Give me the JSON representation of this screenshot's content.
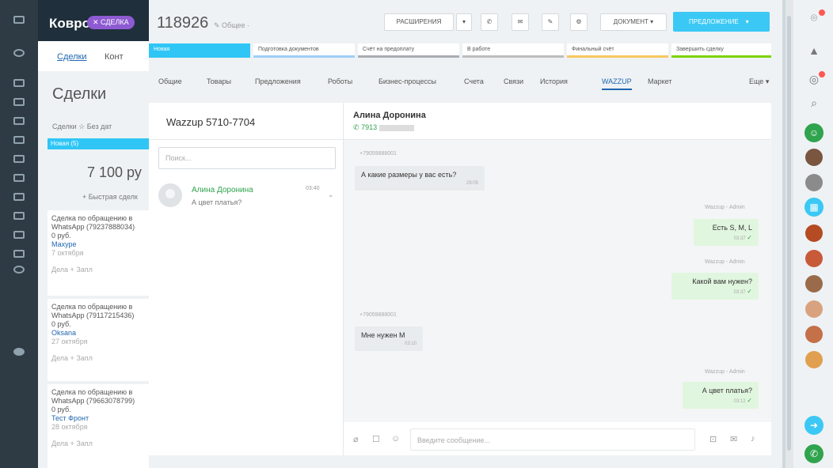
{
  "background": {
    "logo": "Ковро",
    "open_tab_badge": "✕ СДЕЛКА",
    "nav": [
      "Сделки",
      "Конт"
    ],
    "page_title": "Сделки",
    "filter": "Сделки ☆ Без дат",
    "stage": "Новая (5)",
    "sum": "7 100 ру",
    "add_quick": "+ Быстрая сделк",
    "cards": [
      {
        "title": "Сделка по обращению в WhatsApp (79237888034)",
        "amount": "0 руб.",
        "who": "Махуре",
        "date": "7 октября",
        "foot": "Дела      + Запл"
      },
      {
        "title": "Сделка по обращению в WhatsApp (79117215436)",
        "amount": "0 руб.",
        "who": "Oksana",
        "date": "27 октября",
        "foot": "Дела      + Запл"
      },
      {
        "title": "Сделка по обращению в WhatsApp (79663078799)",
        "amount": "0 руб.",
        "who": "Тест Фронт",
        "date": "28 октября",
        "foot": "Дела      + Запл"
      }
    ]
  },
  "deal": {
    "id": "118926",
    "category": "Общее ·",
    "toolbar": {
      "extensions": "РАСШИРЕНИЯ",
      "document": "ДОКУМЕНТ",
      "primary": "ПРЕДЛОЖЕНИЕ"
    },
    "stages": [
      {
        "label": "Новая",
        "color": "#2fc6f6"
      },
      {
        "label": "Подготовка документов",
        "color": "#9dcef8"
      },
      {
        "label": "Счёт на предоплату",
        "color": "#a8adb4"
      },
      {
        "label": "В работе",
        "color": "#bdbdbd"
      },
      {
        "label": "Финальный счёт",
        "color": "#f7c75f"
      },
      {
        "label": "Завершить сделку",
        "color": "#7bd500"
      }
    ],
    "tabs": [
      "Общие",
      "Товары",
      "Предложения",
      "Роботы",
      "Бизнес-процессы",
      "Счета",
      "Связи",
      "История",
      "WAZZUP",
      "Маркет"
    ],
    "tabs_more": "Еще",
    "active_tab": "WAZZUP"
  },
  "chat": {
    "channel_title": "Wazzup 5710-7704",
    "search_placeholder": "Поиск...",
    "contact": {
      "name": "Алина Доронина",
      "last_message": "А цвет платья?",
      "time": "03:40"
    },
    "peer": {
      "name": "Алина Доронина",
      "phone": "7913"
    },
    "composer_placeholder": "Введите сообщение...",
    "messages": [
      {
        "dir": "in",
        "sender": "+79059888001",
        "text": "А какие размеры у вас есть?",
        "time": "29:05"
      },
      {
        "dir": "out",
        "sender": "Wazzup - Admin",
        "text": "Есть S, M, L",
        "time": "03:37"
      },
      {
        "dir": "out",
        "sender": "Wazzup - Admin",
        "text": "Какой вам нужен?",
        "time": "03:37"
      },
      {
        "dir": "in",
        "sender": "+79059888001",
        "text": "Мне нужен M",
        "time": "03:10"
      },
      {
        "dir": "out",
        "sender": "Wazzup - Admin",
        "text": "А цвет платья?",
        "time": "03:12"
      }
    ]
  },
  "colors": {
    "accent": "#3bc8f5",
    "link": "#2067b0",
    "whatsapp": "#2fa34d",
    "outgoing": "#e1f6df"
  }
}
